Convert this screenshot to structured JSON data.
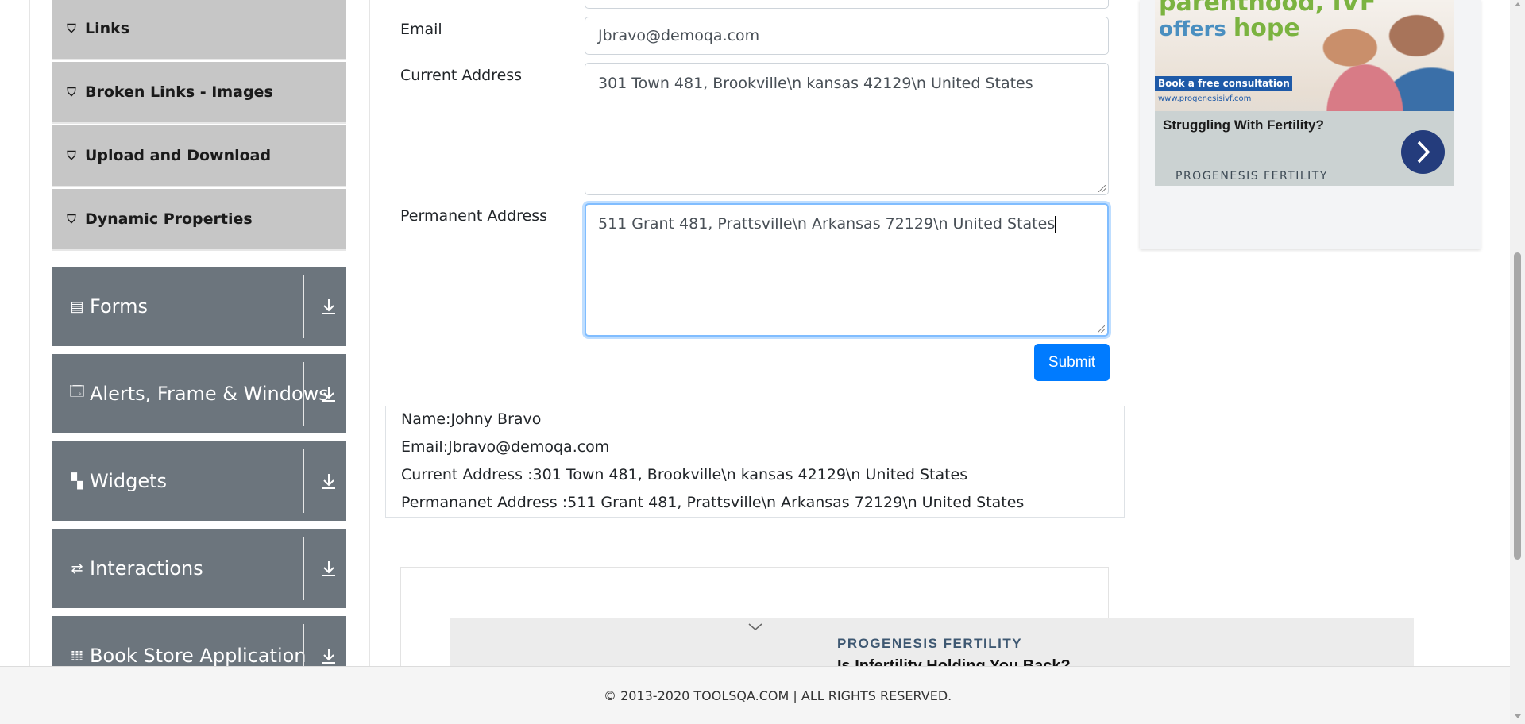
{
  "sidebar": {
    "elements_items": [
      {
        "label": "Links",
        "icon": "html5-icon"
      },
      {
        "label": "Broken Links - Images",
        "icon": "html5-icon"
      },
      {
        "label": "Upload and Download",
        "icon": "html5-icon"
      },
      {
        "label": "Dynamic Properties",
        "icon": "html5-icon"
      }
    ],
    "groups": [
      {
        "label": "Forms",
        "icon": "document-icon"
      },
      {
        "label": "Alerts, Frame & Windows",
        "icon": "window-icon"
      },
      {
        "label": "Widgets",
        "icon": "widgets-icon"
      },
      {
        "label": "Interactions",
        "icon": "interactions-icon"
      },
      {
        "label": "Book Store Application",
        "icon": "books-icon"
      }
    ]
  },
  "form": {
    "email": {
      "label": "Email",
      "value": "Jbravo@demoqa.com"
    },
    "current_address": {
      "label": "Current Address",
      "value": "301 Town 481, Brookville\\n kansas 42129\\n United States"
    },
    "permanent_address": {
      "label": "Permanent Address",
      "value": "511 Grant 481, Prattsville\\n Arkansas 72129\\n United States"
    },
    "submit_label": "Submit"
  },
  "output": {
    "name": "Name:Johny Bravo",
    "email": "Email:Jbravo@demoqa.com",
    "current_address": "Current Address :301 Town 481, Brookville\\n kansas 42129\\n United States",
    "permanent_address": "Permananet Address :511 Grant 481, Prattsville\\n Arkansas 72129\\n United States"
  },
  "ad_right": {
    "headline_line1": "parenthood, IVF",
    "headline_line2_a": "offers ",
    "headline_line2_b": "hope",
    "cta": "Book a free consultation",
    "url": "www.progenesisivf.com",
    "question": "Struggling With Fertility?",
    "brand": "PROGENESIS FERTILITY"
  },
  "ad_bottom": {
    "brand": "PROGENESIS FERTILITY",
    "teaser": "Is Infertility Holding You Back?"
  },
  "footer": {
    "text": "© 2013-2020 TOOLSQA.COM | ALL RIGHTS RESERVED."
  },
  "colors": {
    "group_bg": "#6c757d",
    "subitem_bg": "#c6c6c6",
    "primary": "#007bff"
  }
}
